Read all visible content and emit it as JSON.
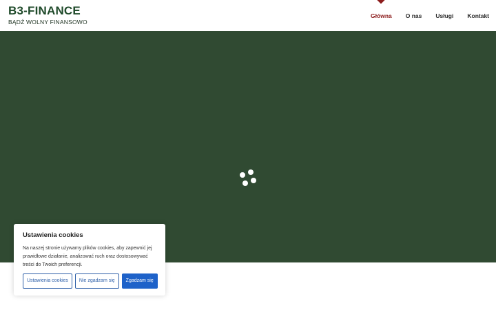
{
  "header": {
    "logo_title": "B3-FINANCE",
    "logo_tagline": "BĄDŹ WOLNY FINANSOWO"
  },
  "nav": {
    "items": [
      {
        "label": "Główna",
        "active": true
      },
      {
        "label": "O nas",
        "active": false
      },
      {
        "label": "Usługi",
        "active": false
      },
      {
        "label": "Kontakt",
        "active": false
      }
    ]
  },
  "hero": {
    "background_color": "#304a32",
    "loader_icon": "loading-dots-icon"
  },
  "cookie_banner": {
    "title": "Ustawienia cookies",
    "text": "Na naszej stronie używamy plików cookies, aby zapewnić jej prawidłowe działanie, analizować ruch oraz dostosowywać treści do Twoich preferencji.",
    "buttons": {
      "settings": "Ustawienia cookies",
      "reject": "Nie zgadzam się",
      "accept": "Zgadzam się"
    }
  },
  "colors": {
    "brand_green": "#1f4a2a",
    "active_nav": "#8c1c1c",
    "button_blue": "#1e62c9"
  }
}
